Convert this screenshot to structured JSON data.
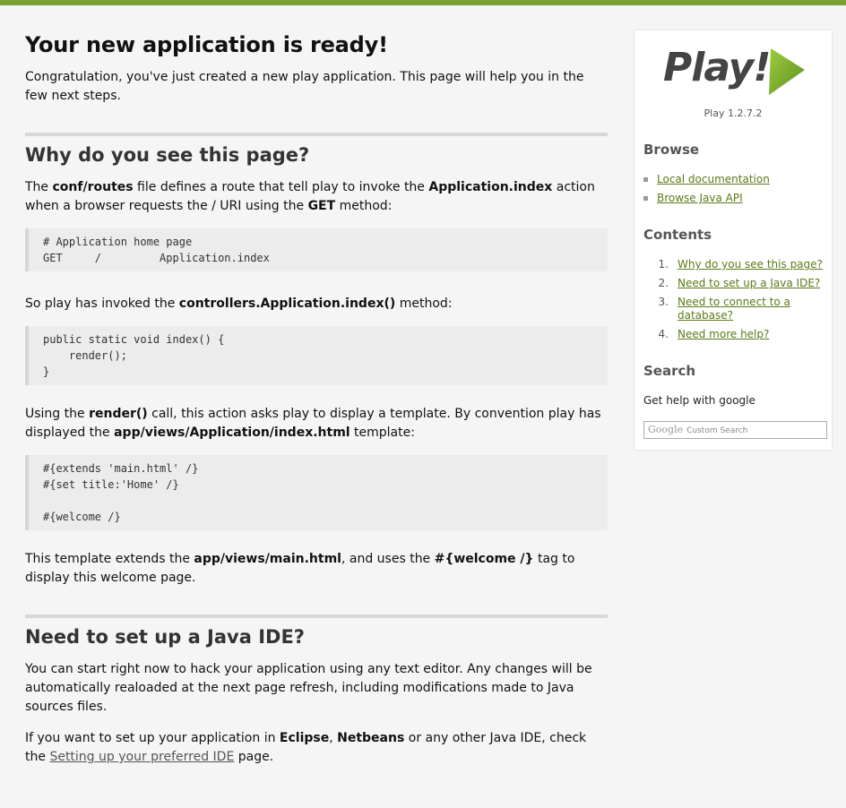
{
  "main": {
    "title": "Your new application is ready!",
    "intro": "Congratulation, you've just created a new play application. This page will help you in the few next steps.",
    "why": {
      "heading": "Why do you see this page?",
      "p1": [
        "The ",
        "conf/routes",
        " file defines a route that tell play to invoke the ",
        "Application.index",
        " action when a browser requests the / URI using the ",
        "GET",
        " method:"
      ],
      "code1": "# Application home page\nGET     /         Application.index",
      "p2": [
        "So play has invoked the ",
        "controllers.Application.index()",
        " method:"
      ],
      "code2": "public static void index() {\n    render();\n}",
      "p3": [
        "Using the ",
        "render()",
        " call, this action asks play to display a template. By convention play has displayed the ",
        "app/views/Application/index.html",
        " template:"
      ],
      "code3": "#{extends 'main.html' /}\n#{set title:'Home' /}\n\n#{welcome /}",
      "p4": [
        "This template extends the ",
        "app/views/main.html",
        ", and uses the ",
        "#{welcome /}",
        " tag to display this welcome page."
      ]
    },
    "ide": {
      "heading": "Need to set up a Java IDE?",
      "p1": "You can start right now to hack your application using any text editor. Any changes will be automatically realoaded at the next page refresh, including modifications made to Java sources files.",
      "p2": [
        "If you want to set up your application in ",
        "Eclipse",
        ", ",
        "Netbeans",
        " or any other Java IDE, check the ",
        "Setting up your preferred IDE",
        " page."
      ]
    }
  },
  "sidebar": {
    "logo_text": "Play!",
    "version": "Play 1.2.7.2",
    "browse_heading": "Browse",
    "browse_links": [
      "Local documentation",
      "Browse Java API"
    ],
    "contents_heading": "Contents",
    "contents": [
      {
        "num": "1.",
        "label": "Why do you see this page?"
      },
      {
        "num": "2.",
        "label": "Need to set up a Java IDE?"
      },
      {
        "num": "3.",
        "label": "Need to connect to a database?"
      },
      {
        "num": "4.",
        "label": "Need more help?"
      }
    ],
    "search_heading": "Search",
    "search_text": "Get help with google",
    "search_brand": "Google",
    "search_placeholder": "Custom Search"
  },
  "colors": {
    "accent": "#78a22f",
    "link": "#5b7a17"
  }
}
